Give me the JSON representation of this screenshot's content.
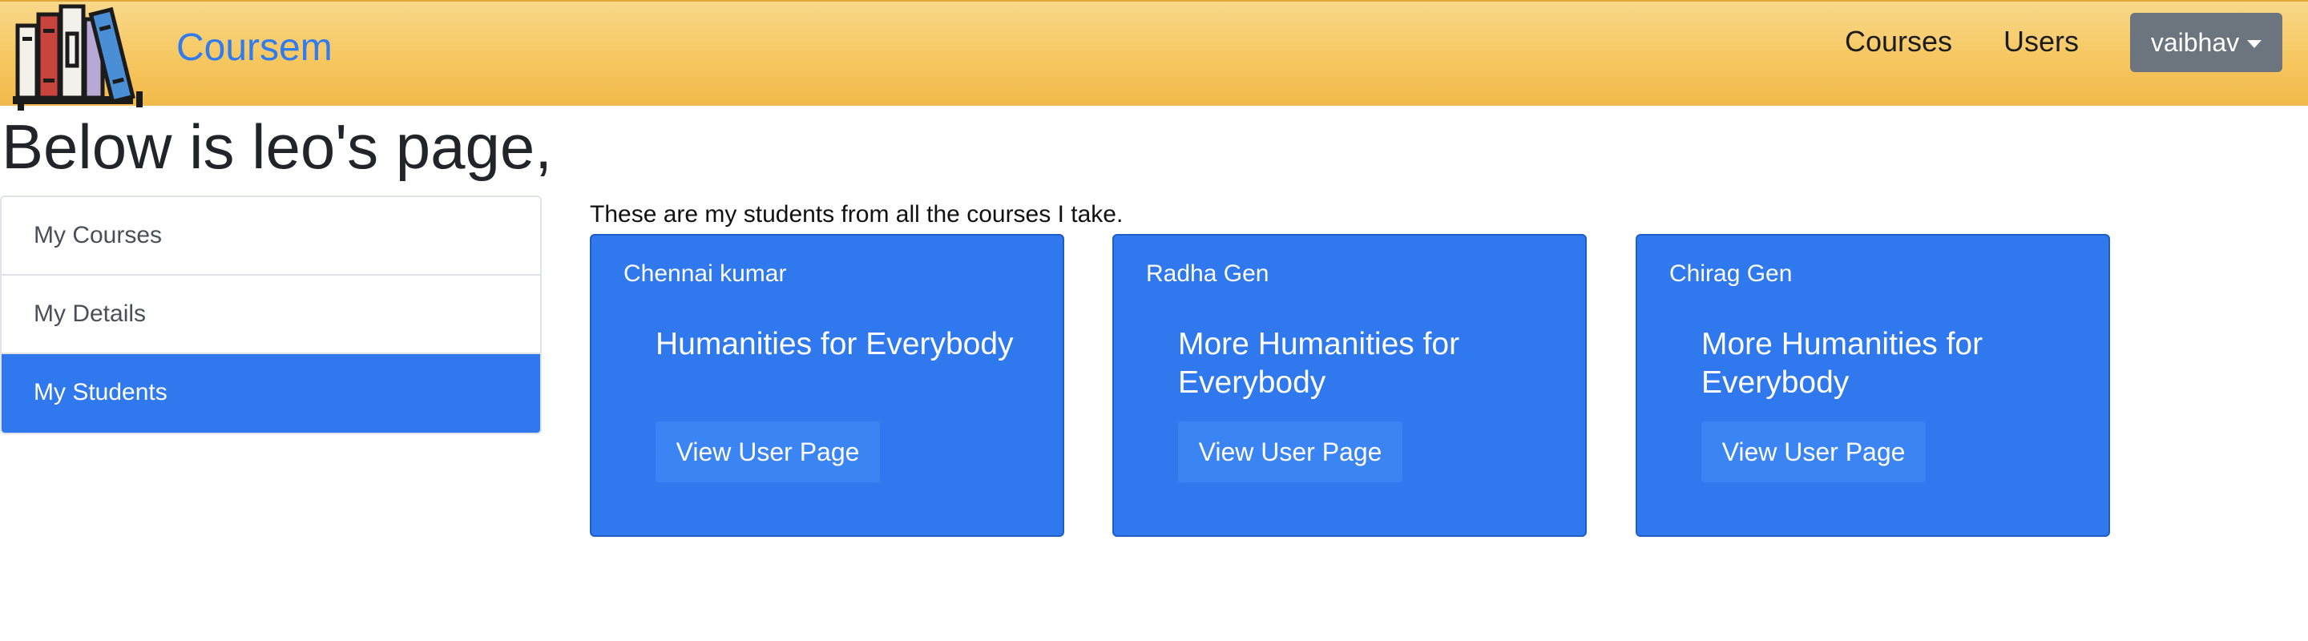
{
  "navbar": {
    "brand": "Coursem",
    "links": [
      "Courses",
      "Users"
    ],
    "user": "vaibhav",
    "brand_color": "#2f7bef",
    "background": "#f6c760",
    "logo_icon": "books-icon"
  },
  "page": {
    "title": "Below is leo's page,"
  },
  "sidebar": {
    "items": [
      {
        "label": "My Courses",
        "active": false
      },
      {
        "label": "My Details",
        "active": false
      },
      {
        "label": "My Students",
        "active": true
      }
    ],
    "active_color": "#2f78ee"
  },
  "main": {
    "intro": "These are my students from all the courses I take.",
    "cards": [
      {
        "student": "Chennai kumar",
        "course": "Humanities for Everybody",
        "button": "View User Page"
      },
      {
        "student": "Radha Gen",
        "course": "More Humanities for Everybody",
        "button": "View User Page"
      },
      {
        "student": "Chirag Gen",
        "course": "More Humanities for Everybody",
        "button": "View User Page"
      }
    ],
    "card_color": "#2f78ee"
  }
}
